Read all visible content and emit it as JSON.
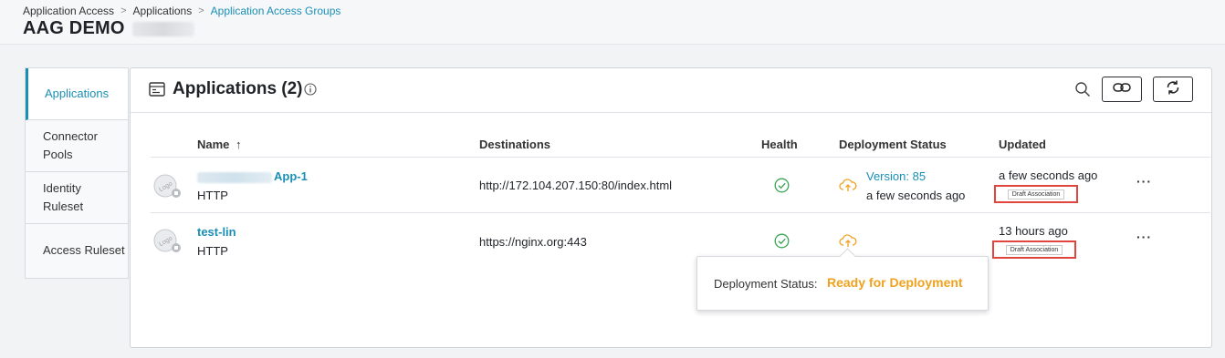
{
  "breadcrumb": {
    "items": [
      "Application Access",
      "Applications",
      "Application Access Groups"
    ],
    "separator": ">"
  },
  "page_title": "AAG DEMO",
  "side_nav": {
    "items": [
      {
        "label": "Applications",
        "active": true
      },
      {
        "label": "Connector Pools",
        "active": false
      },
      {
        "label": "Identity Ruleset",
        "active": false
      },
      {
        "label": "Access Ruleset",
        "active": false
      }
    ]
  },
  "panel": {
    "title": "Applications (2)",
    "toolbar": {
      "icons": [
        "search-icon",
        "link-icon",
        "refresh-icon"
      ]
    }
  },
  "table": {
    "columns": {
      "name": "Name",
      "name_sort": "↑",
      "destinations": "Destinations",
      "health": "Health",
      "deployment_status": "Deployment Status",
      "updated": "Updated"
    },
    "rows": [
      {
        "name": "App-1",
        "type": "HTTP",
        "destination": "http://172.104.207.150:80/index.html",
        "health": "ok",
        "deploy_version": "Version: 85",
        "deploy_time": "a few seconds ago",
        "updated": "a few seconds ago",
        "badge": "Draft Association"
      },
      {
        "name": "test-lin",
        "type": "HTTP",
        "destination": "https://nginx.org:443",
        "health": "ok",
        "deploy_version": "",
        "deploy_time": "",
        "updated": "13 hours ago",
        "badge": "Draft Association"
      }
    ]
  },
  "tooltip": {
    "label": "Deployment Status:",
    "value": "Ready for Deployment"
  },
  "colors": {
    "accent": "#1a8fb5",
    "health_ok": "#3aa655",
    "deploy_pending": "#f0a21e",
    "badge_border": "#e0453e"
  }
}
